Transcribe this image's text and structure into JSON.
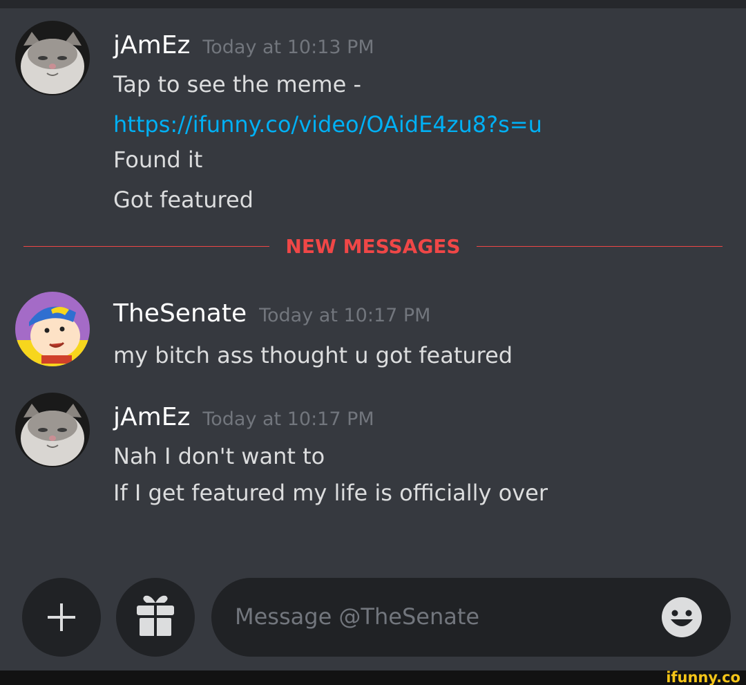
{
  "messages": [
    {
      "username": "jAmEz",
      "timestamp": "Today at 10:13 PM",
      "lines": [
        "Tap to see the meme -",
        "https://ifunny.co/video/OAidE4zu8?s=u",
        "Found it",
        "Got featured"
      ]
    },
    {
      "username": "TheSenate",
      "timestamp": "Today at 10:17 PM",
      "lines": [
        "my bitch ass thought u got featured"
      ]
    },
    {
      "username": "jAmEz",
      "timestamp": "Today at 10:17 PM",
      "lines": [
        "Nah I don't want to",
        "If I get featured my life is officially over"
      ]
    }
  ],
  "divider": {
    "label": "NEW MESSAGES"
  },
  "composer": {
    "placeholder": "Message @TheSenate",
    "add_icon": "plus-icon",
    "gift_icon": "gift-icon",
    "emoji_icon": "emoji-icon"
  },
  "watermark": "ifunny.co",
  "colors": {
    "background": "#36393f",
    "input_background": "#202225",
    "username": "#ffffff",
    "text": "#dcddde",
    "timestamp": "#72767d",
    "link": "#00b0f4",
    "new_messages": "#f04747",
    "watermark": "#f5c518"
  }
}
